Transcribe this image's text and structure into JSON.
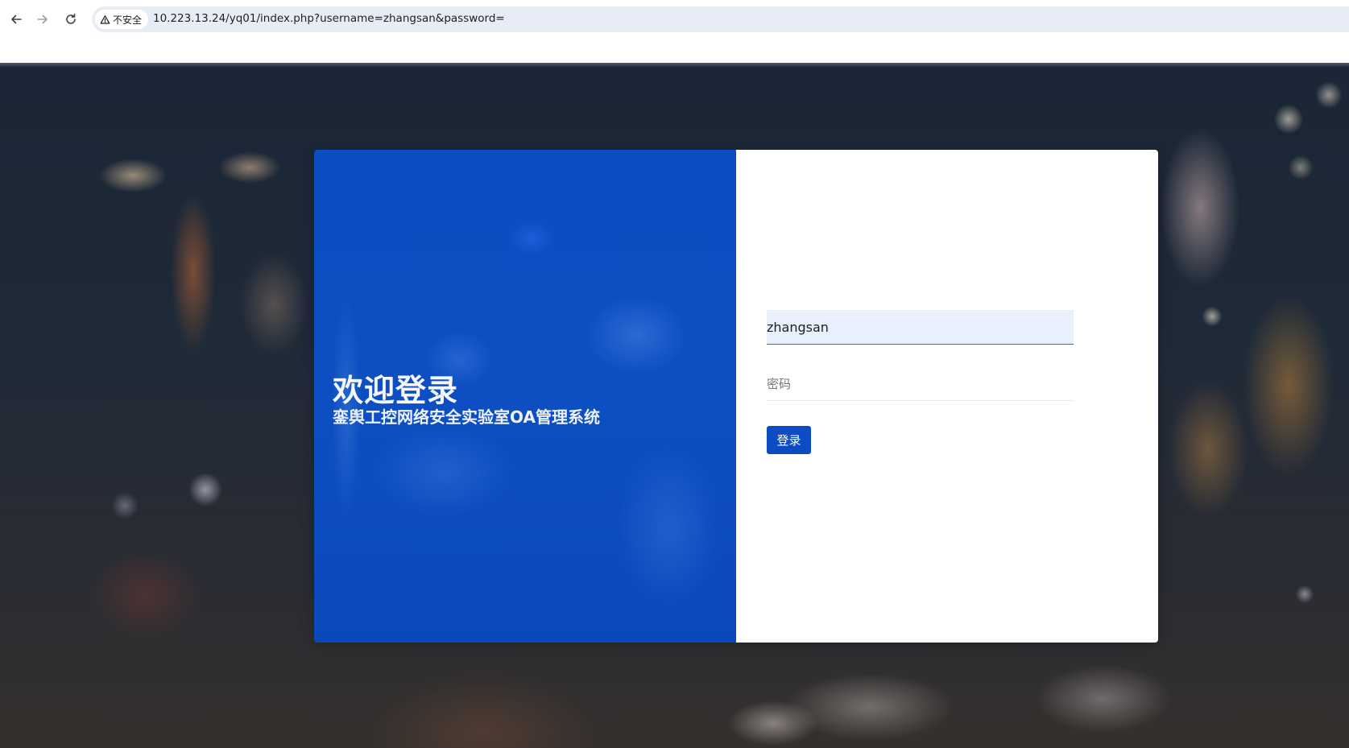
{
  "browser": {
    "security_label": "不安全",
    "url": "10.223.13.24/yq01/index.php?username=zhangsan&password=",
    "icons": {
      "back": "arrow-left-icon",
      "forward": "arrow-right-icon",
      "reload": "reload-icon",
      "security": "warning-triangle-icon"
    }
  },
  "login": {
    "welcome_title": "欢迎登录",
    "system_name": "銮舆工控网络安全实验室OA管理系统",
    "username_value": "zhangsan",
    "password_placeholder": "密码",
    "submit_label": "登录"
  },
  "colors": {
    "left_panel_blue": "#0d4fc2",
    "button_blue": "#0b4cc3",
    "username_autofill_bg": "#e8f0fe"
  }
}
